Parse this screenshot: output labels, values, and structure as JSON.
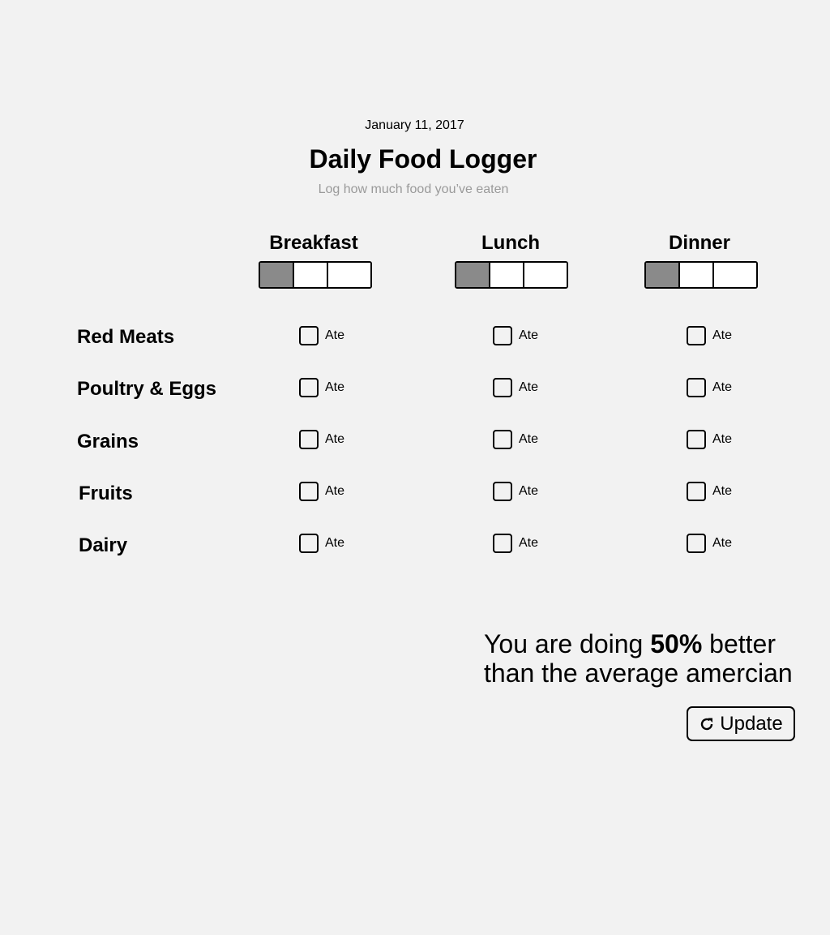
{
  "header": {
    "date": "January 11, 2017",
    "title": "Daily Food Logger",
    "subtitle": "Log how much food you’ve eaten"
  },
  "meals": [
    {
      "label": "Breakfast",
      "portion_level": 1,
      "portion_max": 3
    },
    {
      "label": "Lunch",
      "portion_level": 1,
      "portion_max": 3
    },
    {
      "label": "Dinner",
      "portion_level": 1,
      "portion_max": 3
    }
  ],
  "foods": [
    {
      "label": "Red Meats",
      "ate": [
        false,
        false,
        false
      ]
    },
    {
      "label": "Poultry & Eggs",
      "ate": [
        false,
        false,
        false
      ]
    },
    {
      "label": "Grains",
      "ate": [
        false,
        false,
        false
      ]
    },
    {
      "label": "Fruits",
      "ate": [
        false,
        false,
        false
      ]
    },
    {
      "label": "Dairy",
      "ate": [
        false,
        false,
        false
      ]
    }
  ],
  "checkbox_label": "Ate",
  "summary": {
    "prefix": "You are doing ",
    "percent": "50%",
    "suffix_line1": " better",
    "line2": "than the average amercian"
  },
  "update_button": {
    "label": "Update",
    "icon": "refresh-icon"
  },
  "colors": {
    "background": "#f2f2f2",
    "portion_filled": "#8a8a8a",
    "subtitle": "#9a9a9a"
  }
}
